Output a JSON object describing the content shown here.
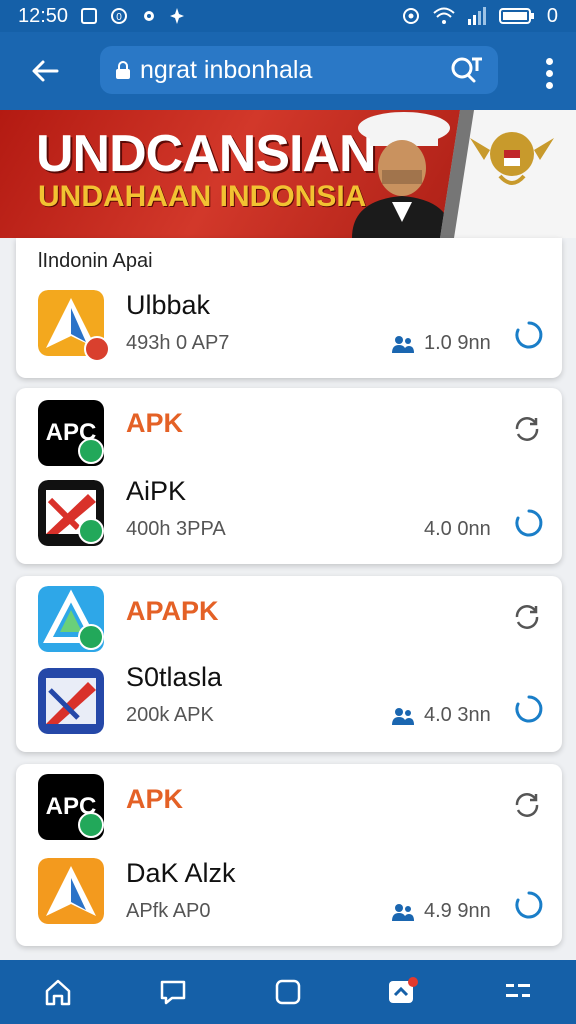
{
  "status_bar": {
    "time": "12:50",
    "battery": "0"
  },
  "search": {
    "text": "ngrat inbonhala"
  },
  "banner": {
    "title": "UNDCANSIAN",
    "subtitle": "UNDAHAAN INDONSIA"
  },
  "section": {
    "label": "lIndonin Apai"
  },
  "cards": [
    {
      "name": "Ulbbak",
      "meta": "493h 0 AP7",
      "count": "1.0 9nn"
    },
    {
      "org": "APK",
      "name": "AiPK",
      "meta": "400h 3PPA",
      "count": "4.0 0nn"
    },
    {
      "org": "APAPK",
      "name": "S0tlasla",
      "meta": "200k APK",
      "count": "4.0 3nn"
    },
    {
      "org": "APK",
      "name": "DaK Alzk",
      "meta": "APfk AP0",
      "count": "4.9 9nn"
    }
  ],
  "icons": {
    "apc_text": "APC",
    "colors": {
      "primary": "#1a66b0",
      "accent": "#e46126",
      "badge_green": "#22a85a"
    }
  }
}
